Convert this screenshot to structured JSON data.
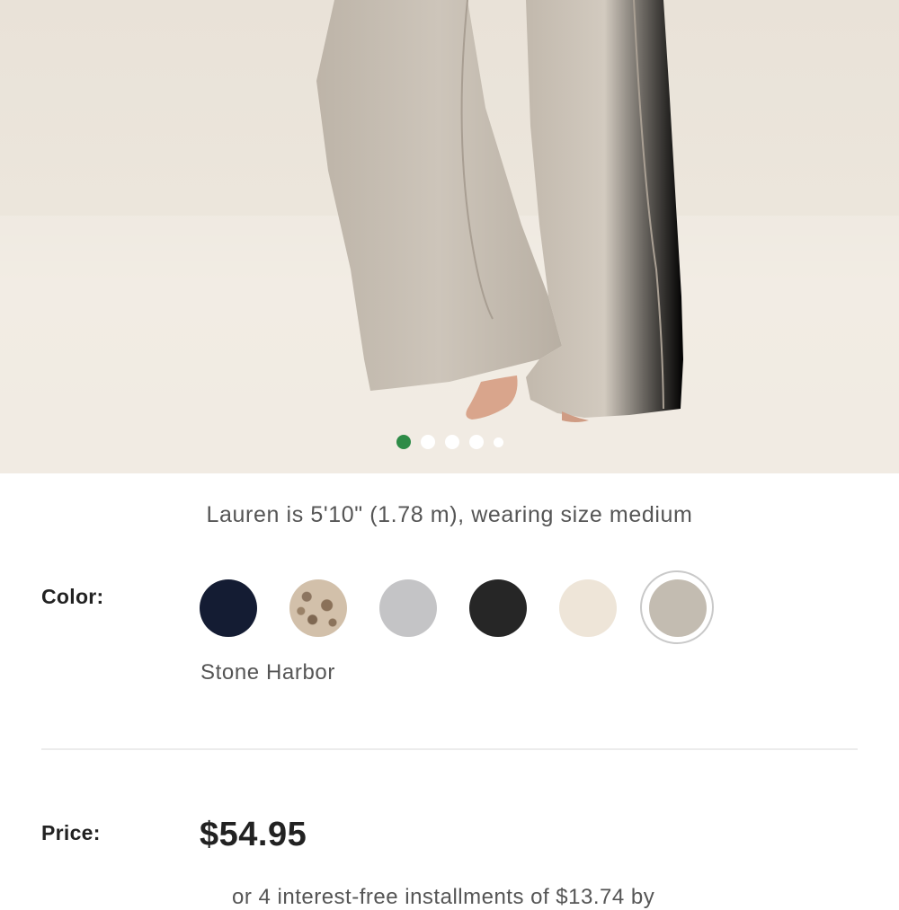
{
  "product": {
    "model_caption": "Lauren is 5'10\" (1.78 m), wearing size medium",
    "gallery": {
      "image_count": 5,
      "active_index": 1
    },
    "color": {
      "label": "Color:",
      "selected_name": "Stone Harbor",
      "swatches": [
        {
          "name": "navy",
          "hex": "#141c33"
        },
        {
          "name": "leopard",
          "hex": "#c9b59e"
        },
        {
          "name": "heather-gray",
          "hex": "#c4c4c6"
        },
        {
          "name": "black",
          "hex": "#262626"
        },
        {
          "name": "cream",
          "hex": "#eee5d8"
        },
        {
          "name": "stone-harbor",
          "hex": "#c3bcb1"
        }
      ]
    },
    "price": {
      "label": "Price:",
      "value": "$54.95",
      "installment_text": "or 4 interest-free installments of $13.74 by"
    }
  },
  "colors": {
    "accent": "#2e8b47",
    "text": "#222222",
    "muted_text": "#555555"
  }
}
